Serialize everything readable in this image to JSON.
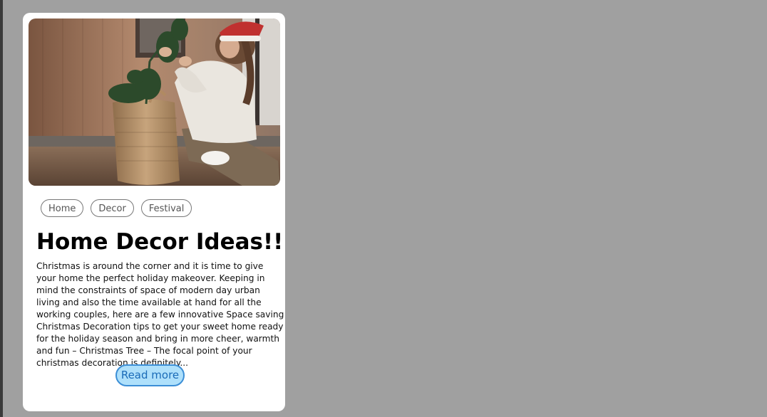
{
  "card": {
    "image_alt": "Woman decorating a small christmas tree in a basket",
    "tags": [
      "Home",
      "Decor",
      "Festival"
    ],
    "title": "Home Decor Ideas!!",
    "description": "Christmas is around the corner and it is time to give your home the perfect holiday makeover. Keeping in mind the constraints of space of modern day urban living and also the time available at hand for all the working couples, here are a few innovative Space saving Christmas Decoration tips to get your sweet home ready for the holiday season and bring in more cheer, warmth and fun – Christmas Tree – The focal point of your christmas decoration is definitely...",
    "read_more_label": "Read more"
  },
  "colors": {
    "page_background": "#a0a0a0",
    "card_background": "#ffffff",
    "button_fill": "#aee0fb",
    "button_border": "#3b8ed6",
    "button_text": "#1a6bb8"
  }
}
